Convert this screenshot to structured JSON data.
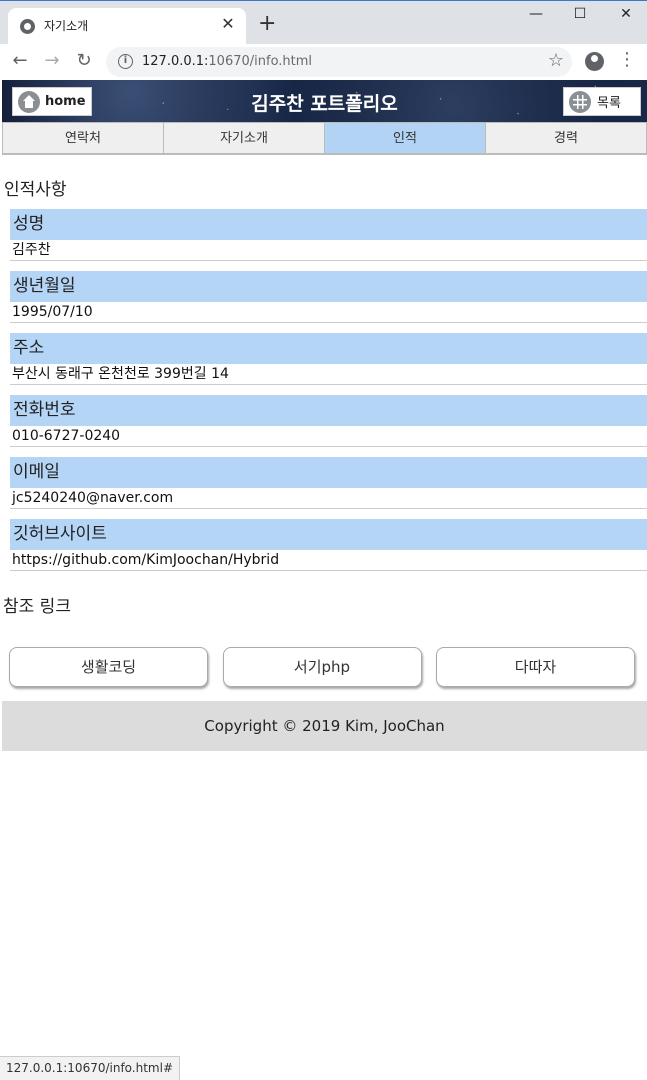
{
  "browser": {
    "tab_title": "자기소개",
    "tab_close": "✕",
    "new_tab": "+",
    "window_controls": {
      "minimize": "—",
      "maximize": "☐",
      "close": "✕"
    },
    "nav": {
      "back": "←",
      "forward": "→",
      "reload": "↻"
    },
    "url_host": "127.0.0.1:",
    "url_rest": "10670/info.html",
    "info_icon": "i",
    "bookmark_icon": "☆",
    "menu_icon": "⋮",
    "status_text": "127.0.0.1:10670/info.html#"
  },
  "header": {
    "home_label": "home",
    "title": "김주찬 포트폴리오",
    "list_label": "목록"
  },
  "nav_tabs": [
    {
      "label": "연락처"
    },
    {
      "label": "자기소개"
    },
    {
      "label": "인적"
    },
    {
      "label": "경력"
    }
  ],
  "active_tab": "인적",
  "personal": {
    "section_title": "인적사항",
    "items": [
      {
        "label": "성명",
        "value": "김주찬"
      },
      {
        "label": "생년월일",
        "value": "1995/07/10"
      },
      {
        "label": "주소",
        "value": "부산시 동래구 온천천로 399번길 14"
      },
      {
        "label": "전화번호",
        "value": "010-6727-0240"
      },
      {
        "label": "이메일",
        "value": "jc5240240@naver.com"
      },
      {
        "label": "깃허브사이트",
        "value": "https://github.com/KimJoochan/Hybrid"
      }
    ]
  },
  "references": {
    "section_title": "참조 링크",
    "links": [
      {
        "label": "생활코딩"
      },
      {
        "label": "서기php"
      },
      {
        "label": "다따자"
      }
    ]
  },
  "footer": {
    "copyright": "Copyright © 2019 Kim, JooChan"
  },
  "colors": {
    "label_bg": "#b5d5f7",
    "active_tab_bg": "#b3d3f5",
    "footer_bg": "#dcdcdc"
  }
}
